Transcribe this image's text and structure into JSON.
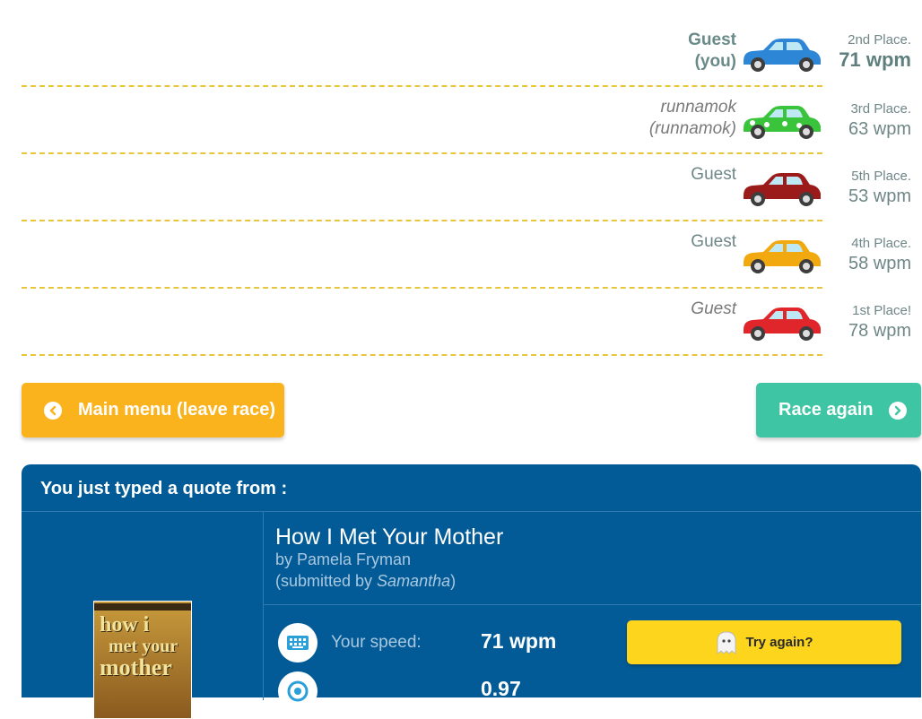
{
  "racers": [
    {
      "name": "Guest",
      "handle": "(you)",
      "rank": "2nd Place.",
      "wpm": "71 wpm",
      "color": "#2e86d6"
    },
    {
      "name": "runnamok",
      "handle": "(runnamok)",
      "rank": "3rd Place.",
      "wpm": "63 wpm",
      "color": "#39c43b"
    },
    {
      "name": "Guest",
      "handle": "",
      "rank": "5th Place.",
      "wpm": "53 wpm",
      "color": "#9b1b1b"
    },
    {
      "name": "Guest",
      "handle": "",
      "rank": "4th Place.",
      "wpm": "58 wpm",
      "color": "#f2a90f"
    },
    {
      "name": "Guest",
      "handle": "",
      "rank": "1st Place!",
      "wpm": "78 wpm",
      "color": "#e0262b"
    }
  ],
  "buttons": {
    "main_menu": "Main menu (leave race)",
    "race_again": "Race again"
  },
  "quote": {
    "header": "You just typed a quote from :",
    "title": "How I Met Your Mother",
    "author": "by Pamela Fryman",
    "submitted_prefix": "(submitted by ",
    "submitter": "Samantha",
    "submitted_suffix": ")",
    "cover_title_line1": "how i",
    "cover_title_line2": "met your",
    "cover_title_line3": "mother"
  },
  "stats": {
    "speed_label": "Your speed:",
    "speed_value": "71 wpm",
    "second_value": "0.97"
  },
  "try_again": "Try again?"
}
